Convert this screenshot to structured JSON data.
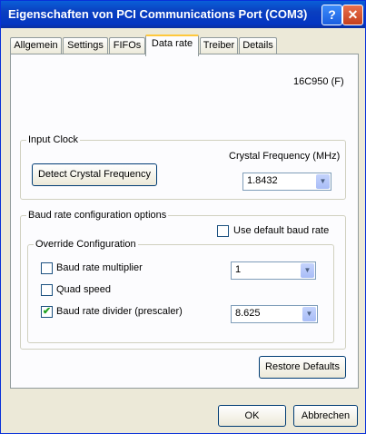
{
  "window": {
    "title": "Eigenschaften von PCI Communications Port (COM3)"
  },
  "titlebar_buttons": {
    "help": "?",
    "close": "✕"
  },
  "tabs": [
    "Allgemein",
    "Settings",
    "FIFOs",
    "Data rate",
    "Treiber",
    "Details"
  ],
  "active_tab": "Data rate",
  "chip": "16C950 (F)",
  "input_clock": {
    "legend": "Input Clock",
    "crystal_label": "Crystal Frequency (MHz)",
    "detect_button": "Detect Crystal Frequency",
    "crystal_value": "1.8432"
  },
  "baud": {
    "legend": "Baud rate configuration options",
    "use_default_label": "Use default baud rate",
    "use_default_checked": false,
    "override": {
      "legend": "Override Configuration",
      "multiplier_label": "Baud rate multiplier",
      "multiplier_checked": false,
      "multiplier_value": "1",
      "quad_label": "Quad speed",
      "quad_checked": false,
      "divider_label": "Baud rate divider (prescaler)",
      "divider_checked": true,
      "divider_value": "8.625"
    }
  },
  "restore_button": "Restore Defaults",
  "ok_button": "OK",
  "cancel_button": "Abbrechen",
  "check_glyph": "✔",
  "arrow_glyph": "▼"
}
